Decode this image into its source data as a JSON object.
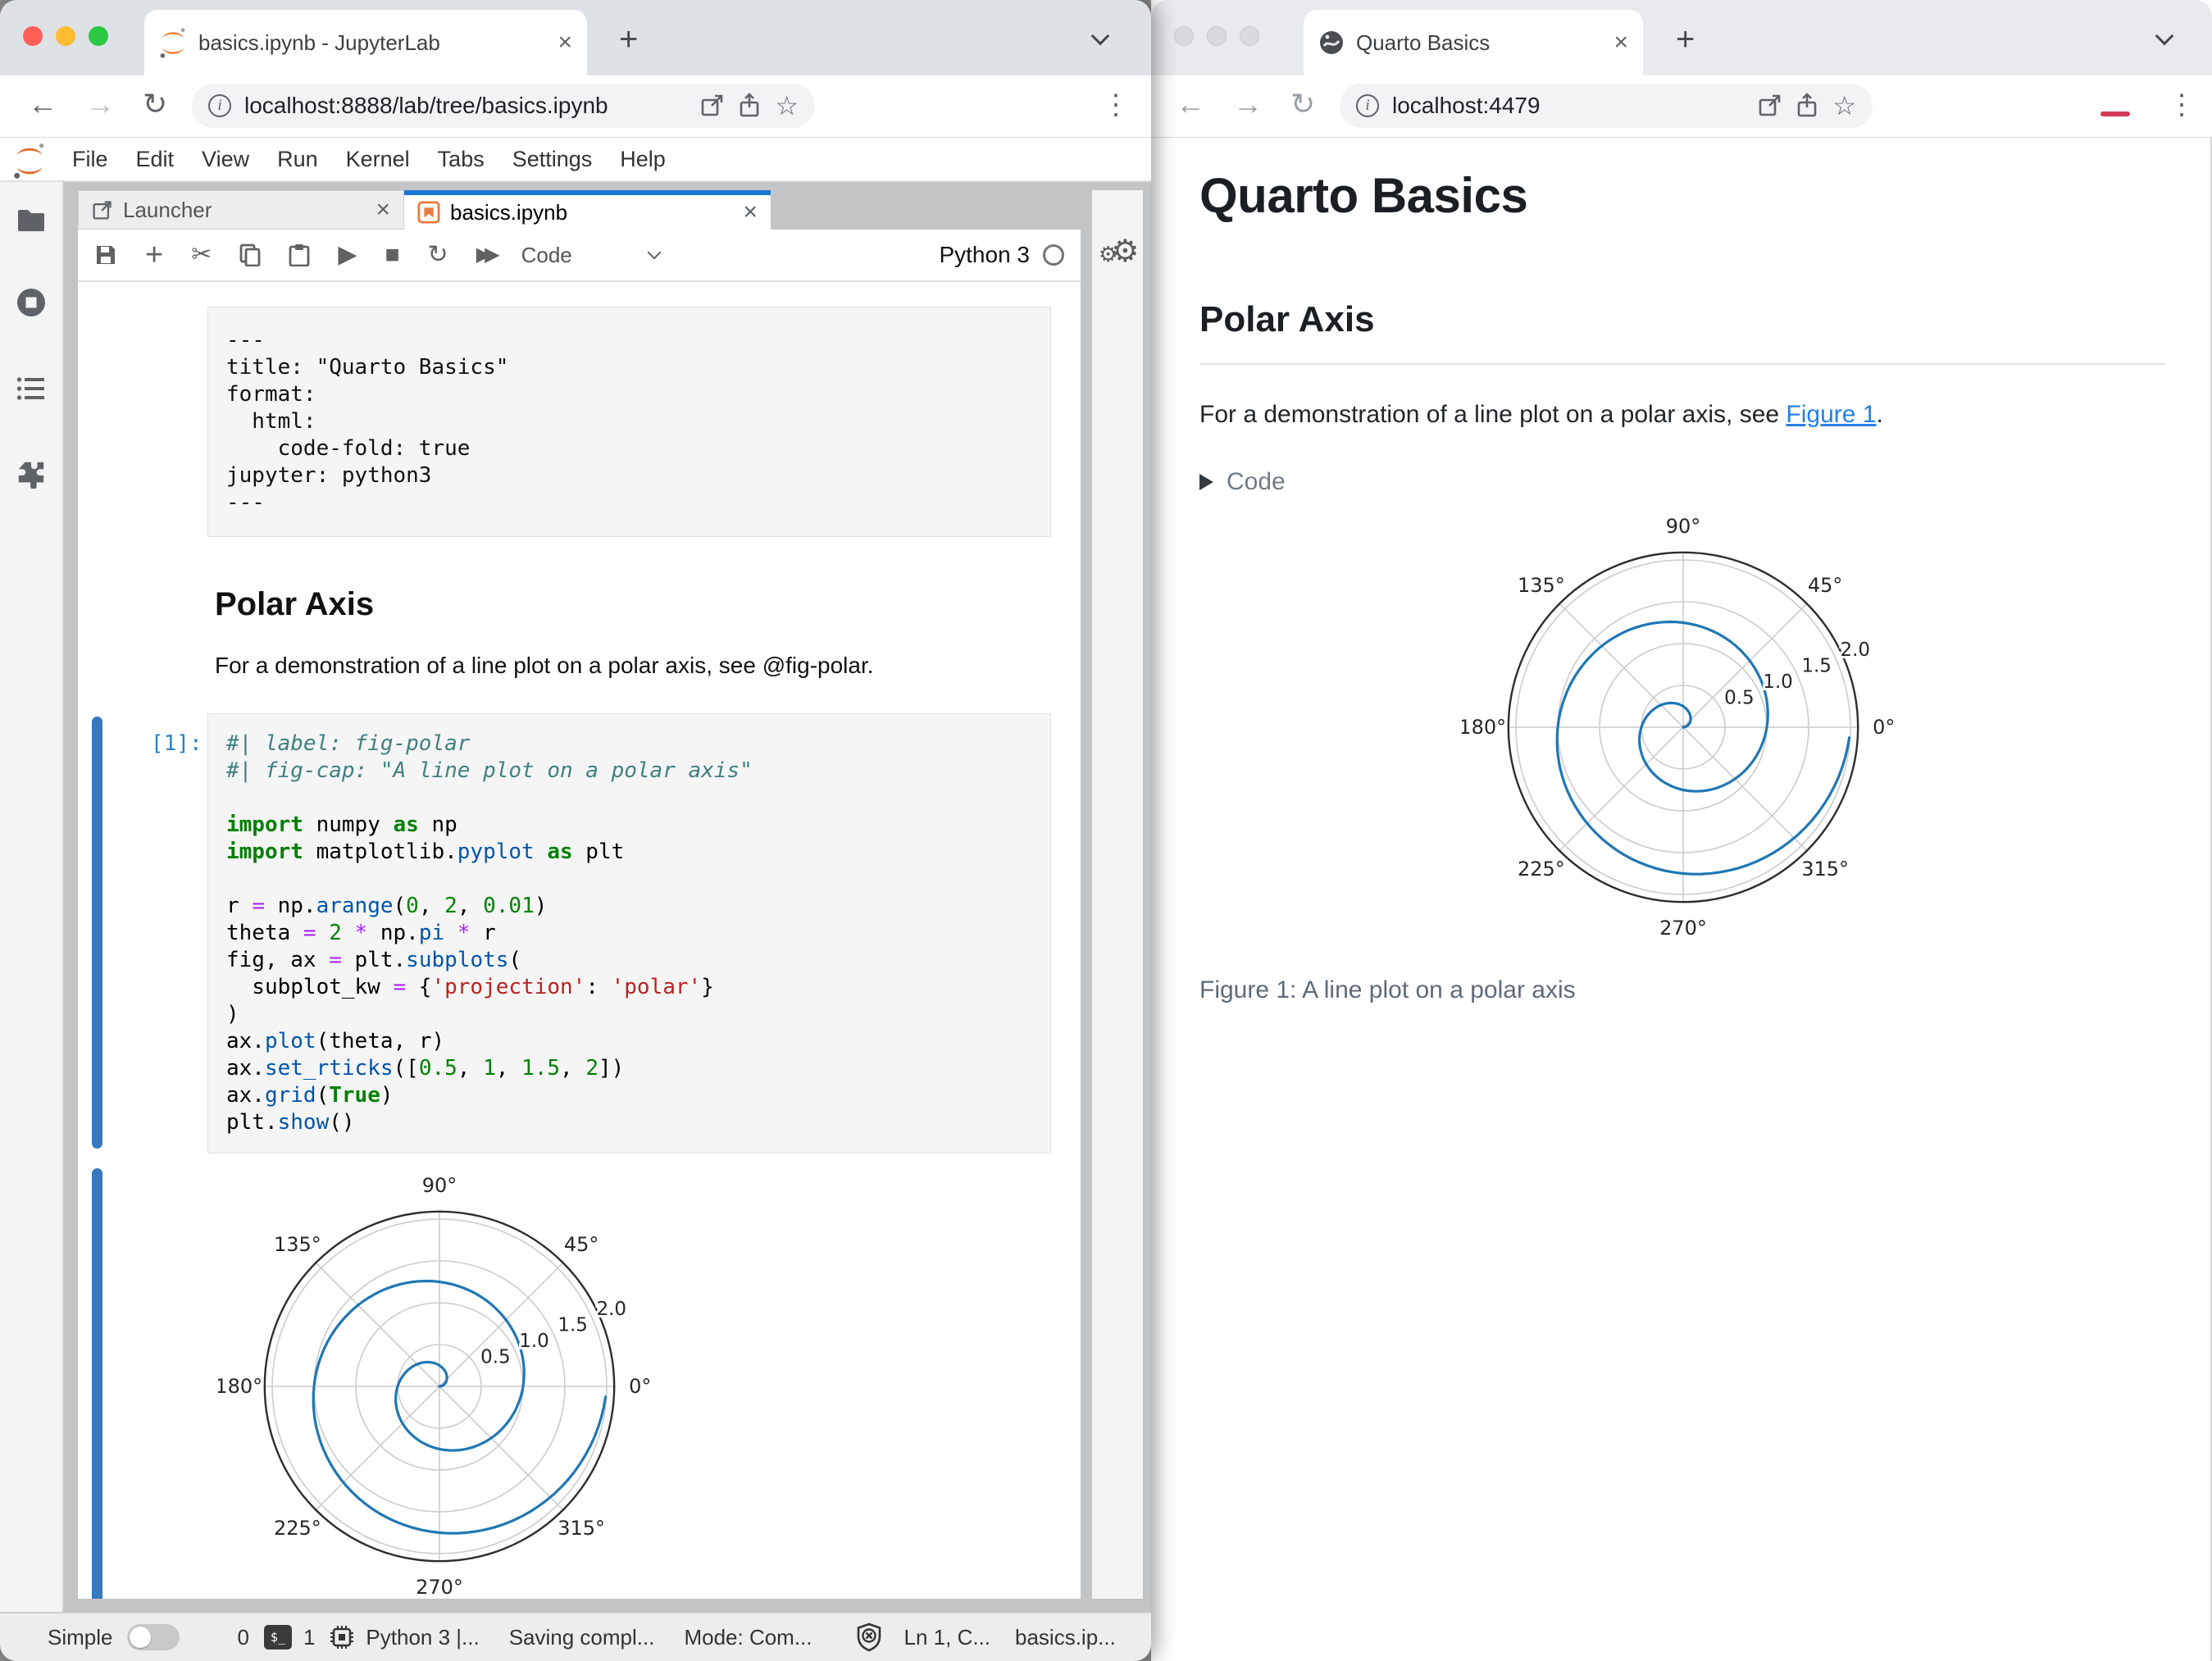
{
  "left_window": {
    "tab_title": "basics.ipynb - JupyterLab",
    "url": "localhost:8888/lab/tree/basics.ipynb",
    "menu": [
      "File",
      "Edit",
      "View",
      "Run",
      "Kernel",
      "Tabs",
      "Settings",
      "Help"
    ],
    "doc_tabs": {
      "launcher": "Launcher",
      "notebook": "basics.ipynb"
    },
    "toolbar": {
      "cell_type": "Code",
      "kernel_name": "Python 3"
    },
    "notebook": {
      "yaml_lines": [
        "---",
        "title: \"Quarto Basics\"",
        "format:",
        "  html:",
        "    code-fold: true",
        "jupyter: python3",
        "---"
      ],
      "heading": "Polar Axis",
      "paragraph": "For a demonstration of a line plot on a polar axis, see @fig-polar.",
      "prompt": "[1]:",
      "code_lines": [
        [
          [
            "c",
            "#| label: fig-polar"
          ]
        ],
        [
          [
            "c",
            "#| fig-cap: \"A line plot on a polar axis\""
          ]
        ],
        [],
        [
          [
            "k",
            "import"
          ],
          [
            "t",
            " numpy "
          ],
          [
            "k",
            "as"
          ],
          [
            "t",
            " np"
          ]
        ],
        [
          [
            "k",
            "import"
          ],
          [
            "t",
            " matplotlib."
          ],
          [
            "p",
            "pyplot"
          ],
          [
            "t",
            " "
          ],
          [
            "k",
            "as"
          ],
          [
            "t",
            " plt"
          ]
        ],
        [],
        [
          [
            "t",
            "r "
          ],
          [
            "o",
            "="
          ],
          [
            "t",
            " np."
          ],
          [
            "p",
            "arange"
          ],
          [
            "t",
            "("
          ],
          [
            "n",
            "0"
          ],
          [
            "t",
            ", "
          ],
          [
            "n",
            "2"
          ],
          [
            "t",
            ", "
          ],
          [
            "n",
            "0.01"
          ],
          [
            "t",
            ")"
          ]
        ],
        [
          [
            "t",
            "theta "
          ],
          [
            "o",
            "="
          ],
          [
            "t",
            " "
          ],
          [
            "n",
            "2"
          ],
          [
            "t",
            " "
          ],
          [
            "o",
            "*"
          ],
          [
            "t",
            " np."
          ],
          [
            "p",
            "pi"
          ],
          [
            "t",
            " "
          ],
          [
            "o",
            "*"
          ],
          [
            "t",
            " r"
          ]
        ],
        [
          [
            "t",
            "fig, ax "
          ],
          [
            "o",
            "="
          ],
          [
            "t",
            " plt."
          ],
          [
            "p",
            "subplots"
          ],
          [
            "t",
            "("
          ]
        ],
        [
          [
            "t",
            "  subplot_kw "
          ],
          [
            "o",
            "="
          ],
          [
            "t",
            " {"
          ],
          [
            "s",
            "'projection'"
          ],
          [
            "t",
            ": "
          ],
          [
            "s",
            "'polar'"
          ],
          [
            "t",
            "}"
          ]
        ],
        [
          [
            "t",
            ")"
          ]
        ],
        [
          [
            "t",
            "ax."
          ],
          [
            "p",
            "plot"
          ],
          [
            "t",
            "(theta, r)"
          ]
        ],
        [
          [
            "t",
            "ax."
          ],
          [
            "p",
            "set_rticks"
          ],
          [
            "t",
            "(["
          ],
          [
            "n",
            "0.5"
          ],
          [
            "t",
            ", "
          ],
          [
            "n",
            "1"
          ],
          [
            "t",
            ", "
          ],
          [
            "n",
            "1.5"
          ],
          [
            "t",
            ", "
          ],
          [
            "n",
            "2"
          ],
          [
            "t",
            "])"
          ]
        ],
        [
          [
            "t",
            "ax."
          ],
          [
            "p",
            "grid"
          ],
          [
            "t",
            "("
          ],
          [
            "k",
            "True"
          ],
          [
            "t",
            ")"
          ]
        ],
        [
          [
            "t",
            "plt."
          ],
          [
            "p",
            "show"
          ],
          [
            "t",
            "()"
          ]
        ]
      ]
    },
    "statusbar": {
      "simple_label": "Simple",
      "terminals": "0",
      "kernels": "1",
      "kernel_status": "Python 3 |...",
      "saving": "Saving compl...",
      "mode": "Mode: Com...",
      "cursor": "Ln 1, C...",
      "filename": "basics.ip..."
    }
  },
  "right_window": {
    "tab_title": "Quarto Basics",
    "url": "localhost:4479",
    "article": {
      "title": "Quarto Basics",
      "heading": "Polar Axis",
      "para_before": "For a demonstration of a line plot on a polar axis, see ",
      "link_text": "Figure 1",
      "para_after": ".",
      "code_toggle": "Code",
      "caption": "Figure 1: A line plot on a polar axis"
    }
  },
  "chart_data": {
    "type": "line",
    "projection": "polar",
    "title": "",
    "caption": "A line plot on a polar axis",
    "series": [
      {
        "name": "theta = 2*pi*r",
        "r_start": 0,
        "r_end": 1.99,
        "r_step": 0.01
      }
    ],
    "theta_tick_labels": [
      "0°",
      "45°",
      "90°",
      "135°",
      "180°",
      "225°",
      "270°",
      "315°"
    ],
    "r_ticks": [
      0.5,
      1.0,
      1.5,
      2.0
    ],
    "r_tick_labels": [
      "0.5",
      "1.0",
      "1.5",
      "2.0"
    ],
    "r_max": 2.09,
    "r_label_angle_deg": 22.5,
    "grid": true,
    "line_color": "#1f77b4",
    "grid_color": "#cccccc",
    "spine_color": "#2d2d2d",
    "tick_label_color": "#262626"
  }
}
